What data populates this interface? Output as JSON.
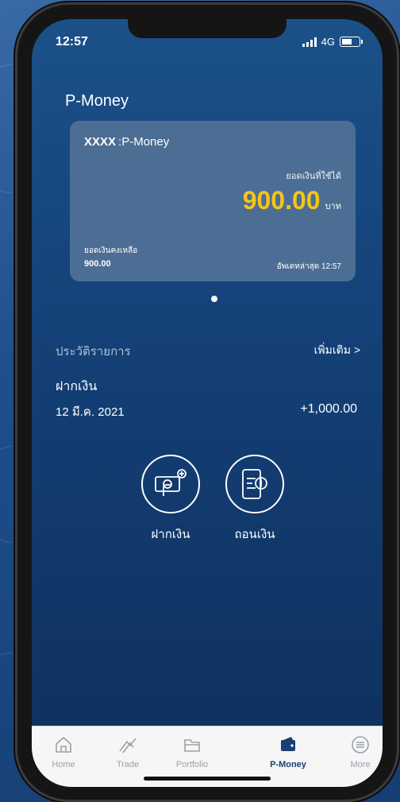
{
  "status": {
    "time": "12:57",
    "network": "4G"
  },
  "page": {
    "title": "P-Money"
  },
  "card": {
    "account_masked": "XXXX",
    "account_name": ":P-Money",
    "available_label": "ยอดเงินที่ใช้ได้",
    "available_amount": "900.00",
    "currency_unit": "บาท",
    "balance_label": "ยอดเงินคงเหลือ",
    "balance_value": "900.00",
    "updated_text": "อัพเดทล่าสุด 12:57"
  },
  "history": {
    "label": "ประวัติรายการ",
    "more": "เพิ่มเติม >",
    "transactions": [
      {
        "type": "ฝากเงิน",
        "date": "12 มี.ค. 2021",
        "amount": "+1,000.00"
      }
    ]
  },
  "actions": [
    {
      "label": "ฝากเงิน",
      "icon": "deposit-icon"
    },
    {
      "label": "ถอนเงิน",
      "icon": "withdraw-icon"
    }
  ],
  "tabs": [
    {
      "label": "Home",
      "icon": "home-icon"
    },
    {
      "label": "Trade",
      "icon": "trade-icon"
    },
    {
      "label": "Portfolio",
      "icon": "portfolio-icon"
    },
    {
      "label": "P-Money",
      "icon": "wallet-icon",
      "active": true
    },
    {
      "label": "More",
      "icon": "menu-icon"
    }
  ],
  "colors": {
    "accent_yellow": "#f5c518",
    "screen_blue": "#144178",
    "card_blue": "#4d6e94",
    "active_tab": "#1b3f73"
  }
}
